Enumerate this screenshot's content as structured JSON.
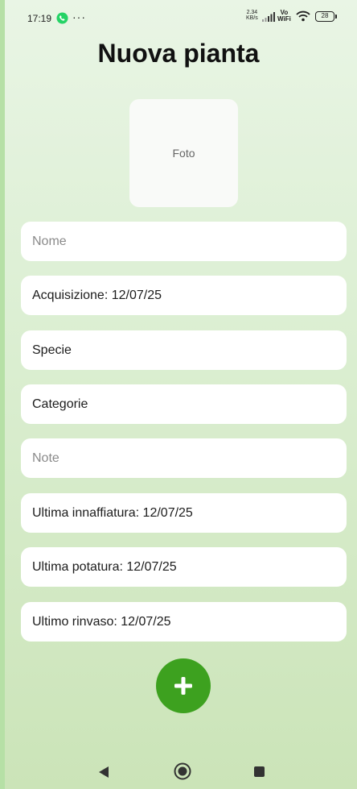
{
  "status_bar": {
    "time": "17:19",
    "dots": "···",
    "net_speed_value": "2.34",
    "net_speed_unit": "KB/s",
    "vo": "Vo",
    "wifi": "WiFi",
    "battery": "28",
    "icons": [
      "whatsapp-icon",
      "signal-icon",
      "wifi-icon",
      "battery-icon"
    ]
  },
  "title": "Nuova pianta",
  "photo": {
    "label": "Foto"
  },
  "fields": {
    "nome_placeholder": "Nome",
    "acquisizione": "Acquisizione: 12/07/25",
    "specie": "Specie",
    "categorie": "Categorie",
    "note_placeholder": "Note",
    "ultima_innaffiatura": "Ultima innaffiatura: 12/07/25",
    "ultima_potatura": "Ultima potatura: 12/07/25",
    "ultimo_rinvaso": "Ultimo rinvaso: 12/07/25"
  },
  "add_button": {
    "icon": "plus-icon",
    "color": "#3da11f"
  },
  "nav": {
    "icons": [
      "back-icon",
      "home-icon",
      "recents-icon"
    ]
  },
  "colors": {
    "background": "#dcefd3",
    "accent": "#3da11f",
    "whatsapp": "#25d366"
  }
}
